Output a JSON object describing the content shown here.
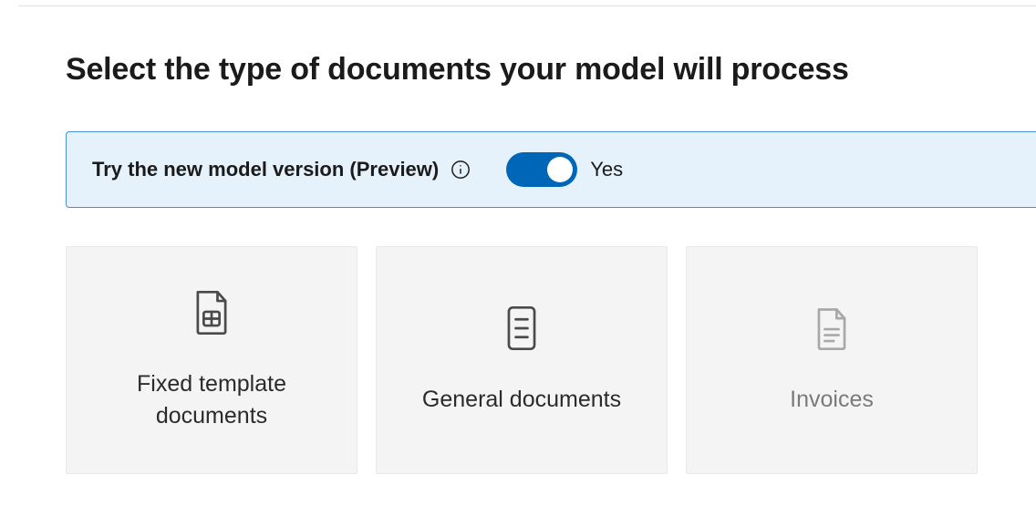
{
  "title": "Select the type of documents your model will process",
  "preview": {
    "label": "Try the new model version (Preview)",
    "toggle_state": "Yes"
  },
  "cards": [
    {
      "label": "Fixed template documents"
    },
    {
      "label": "General documents"
    },
    {
      "label": "Invoices"
    }
  ]
}
